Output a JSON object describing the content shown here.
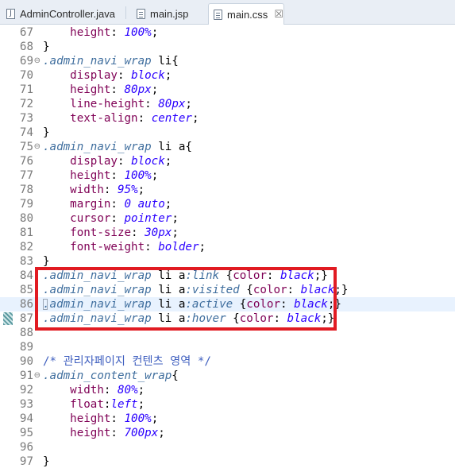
{
  "tabs": [
    {
      "label": "AdminController.java",
      "icon": "java-file-icon",
      "active": false
    },
    {
      "label": "main.jsp",
      "icon": "jsp-file-icon",
      "active": false
    },
    {
      "label": "main.css",
      "icon": "css-file-icon",
      "active": true,
      "close": "☒"
    }
  ],
  "lines": [
    {
      "n": "67",
      "fold": "",
      "seg": [
        [
          "    ",
          "plain"
        ],
        [
          "height",
          "prop"
        ],
        [
          ": ",
          "plain"
        ],
        [
          "100%",
          "val"
        ],
        [
          ";",
          "plain"
        ]
      ]
    },
    {
      "n": "68",
      "fold": "",
      "seg": [
        [
          "}",
          "plain"
        ]
      ]
    },
    {
      "n": "69",
      "fold": "⊖",
      "seg": [
        [
          ".admin_navi_wrap",
          "sel"
        ],
        [
          " li{",
          "plain"
        ]
      ]
    },
    {
      "n": "70",
      "fold": "",
      "seg": [
        [
          "    ",
          "plain"
        ],
        [
          "display",
          "prop"
        ],
        [
          ": ",
          "plain"
        ],
        [
          "block",
          "val"
        ],
        [
          ";",
          "plain"
        ]
      ]
    },
    {
      "n": "71",
      "fold": "",
      "seg": [
        [
          "    ",
          "plain"
        ],
        [
          "height",
          "prop"
        ],
        [
          ": ",
          "plain"
        ],
        [
          "80px",
          "val"
        ],
        [
          ";",
          "plain"
        ]
      ]
    },
    {
      "n": "72",
      "fold": "",
      "seg": [
        [
          "    ",
          "plain"
        ],
        [
          "line-height",
          "prop"
        ],
        [
          ": ",
          "plain"
        ],
        [
          "80px",
          "val"
        ],
        [
          ";",
          "plain"
        ]
      ]
    },
    {
      "n": "73",
      "fold": "",
      "seg": [
        [
          "    ",
          "plain"
        ],
        [
          "text-align",
          "prop"
        ],
        [
          ": ",
          "plain"
        ],
        [
          "center",
          "val"
        ],
        [
          ";",
          "plain"
        ]
      ]
    },
    {
      "n": "74",
      "fold": "",
      "seg": [
        [
          "}",
          "plain"
        ]
      ]
    },
    {
      "n": "75",
      "fold": "⊖",
      "seg": [
        [
          ".admin_navi_wrap",
          "sel"
        ],
        [
          " li a{",
          "plain"
        ]
      ]
    },
    {
      "n": "76",
      "fold": "",
      "seg": [
        [
          "    ",
          "plain"
        ],
        [
          "display",
          "prop"
        ],
        [
          ": ",
          "plain"
        ],
        [
          "block",
          "val"
        ],
        [
          ";",
          "plain"
        ]
      ]
    },
    {
      "n": "77",
      "fold": "",
      "seg": [
        [
          "    ",
          "plain"
        ],
        [
          "height",
          "prop"
        ],
        [
          ": ",
          "plain"
        ],
        [
          "100%",
          "val"
        ],
        [
          ";",
          "plain"
        ]
      ]
    },
    {
      "n": "78",
      "fold": "",
      "seg": [
        [
          "    ",
          "plain"
        ],
        [
          "width",
          "prop"
        ],
        [
          ": ",
          "plain"
        ],
        [
          "95%",
          "val"
        ],
        [
          ";",
          "plain"
        ]
      ]
    },
    {
      "n": "79",
      "fold": "",
      "seg": [
        [
          "    ",
          "plain"
        ],
        [
          "margin",
          "prop"
        ],
        [
          ": ",
          "plain"
        ],
        [
          "0 auto",
          "val"
        ],
        [
          ";",
          "plain"
        ]
      ]
    },
    {
      "n": "80",
      "fold": "",
      "seg": [
        [
          "    ",
          "plain"
        ],
        [
          "cursor",
          "prop"
        ],
        [
          ": ",
          "plain"
        ],
        [
          "pointer",
          "val"
        ],
        [
          ";",
          "plain"
        ]
      ]
    },
    {
      "n": "81",
      "fold": "",
      "seg": [
        [
          "    ",
          "plain"
        ],
        [
          "font-size",
          "prop"
        ],
        [
          ": ",
          "plain"
        ],
        [
          "30px",
          "val"
        ],
        [
          ";",
          "plain"
        ]
      ]
    },
    {
      "n": "82",
      "fold": "",
      "seg": [
        [
          "    ",
          "plain"
        ],
        [
          "font-weight",
          "prop"
        ],
        [
          ": ",
          "plain"
        ],
        [
          "bolder",
          "val"
        ],
        [
          ";",
          "plain"
        ]
      ]
    },
    {
      "n": "83",
      "fold": "",
      "seg": [
        [
          "}",
          "plain"
        ]
      ]
    },
    {
      "n": "84",
      "fold": "",
      "seg": [
        [
          ".admin_navi_wrap",
          "sel"
        ],
        [
          " li a",
          "plain"
        ],
        [
          ":link",
          "sel"
        ],
        [
          " {",
          "plain"
        ],
        [
          "color",
          "prop"
        ],
        [
          ": ",
          "plain"
        ],
        [
          "black",
          "val"
        ],
        [
          ";}",
          "plain"
        ]
      ]
    },
    {
      "n": "85",
      "fold": "",
      "seg": [
        [
          ".admin_navi_wrap",
          "sel"
        ],
        [
          " li a",
          "plain"
        ],
        [
          ":visited",
          "sel"
        ],
        [
          " {",
          "plain"
        ],
        [
          "color",
          "prop"
        ],
        [
          ": ",
          "plain"
        ],
        [
          "black",
          "val"
        ],
        [
          ";}",
          "plain"
        ]
      ]
    },
    {
      "n": "86",
      "fold": "",
      "current": true,
      "seg": [
        [
          ".admin_navi_wrap",
          "sel"
        ],
        [
          " li a",
          "plain"
        ],
        [
          ":active",
          "sel"
        ],
        [
          " {",
          "plain"
        ],
        [
          "color",
          "prop"
        ],
        [
          ": ",
          "plain"
        ],
        [
          "black",
          "val"
        ],
        [
          ";}",
          "plain"
        ]
      ]
    },
    {
      "n": "87",
      "fold": "",
      "marker": true,
      "seg": [
        [
          ".admin_navi_wrap",
          "sel"
        ],
        [
          " li a",
          "plain"
        ],
        [
          ":hover",
          "sel"
        ],
        [
          " {",
          "plain"
        ],
        [
          "color",
          "prop"
        ],
        [
          ": ",
          "plain"
        ],
        [
          "black",
          "val"
        ],
        [
          ";}",
          "plain"
        ]
      ]
    },
    {
      "n": "88",
      "fold": "",
      "seg": []
    },
    {
      "n": "89",
      "fold": "",
      "seg": []
    },
    {
      "n": "90",
      "fold": "",
      "seg": [
        [
          "/* 관리자페이지 컨텐츠 영역 */",
          "cmt"
        ]
      ]
    },
    {
      "n": "91",
      "fold": "⊖",
      "seg": [
        [
          ".admin_content_wrap",
          "sel"
        ],
        [
          "{",
          "plain"
        ]
      ]
    },
    {
      "n": "92",
      "fold": "",
      "seg": [
        [
          "    ",
          "plain"
        ],
        [
          "width",
          "prop"
        ],
        [
          ": ",
          "plain"
        ],
        [
          "80%",
          "val"
        ],
        [
          ";",
          "plain"
        ]
      ]
    },
    {
      "n": "93",
      "fold": "",
      "seg": [
        [
          "    ",
          "plain"
        ],
        [
          "float",
          "prop"
        ],
        [
          ":",
          "plain"
        ],
        [
          "left",
          "val"
        ],
        [
          ";",
          "plain"
        ]
      ]
    },
    {
      "n": "94",
      "fold": "",
      "seg": [
        [
          "    ",
          "plain"
        ],
        [
          "height",
          "prop"
        ],
        [
          ": ",
          "plain"
        ],
        [
          "100%",
          "val"
        ],
        [
          ";",
          "plain"
        ]
      ]
    },
    {
      "n": "95",
      "fold": "",
      "seg": [
        [
          "    ",
          "plain"
        ],
        [
          "height",
          "prop"
        ],
        [
          ": ",
          "plain"
        ],
        [
          "700px",
          "val"
        ],
        [
          ";",
          "plain"
        ]
      ]
    },
    {
      "n": "96",
      "fold": "",
      "seg": []
    },
    {
      "n": "97",
      "fold": "",
      "seg": [
        [
          "}",
          "plain"
        ]
      ]
    }
  ],
  "colors": {
    "highlight_box": "#e11b22",
    "current_line": "#e8f2fe"
  }
}
